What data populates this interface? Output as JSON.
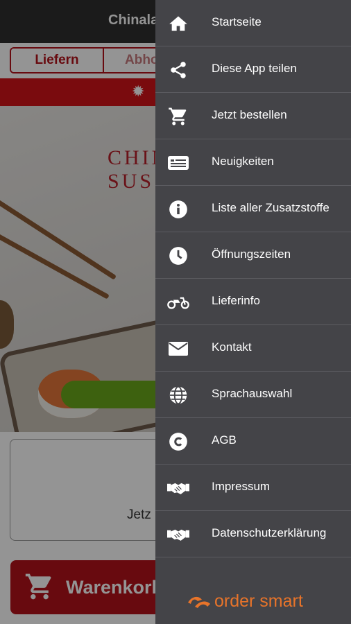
{
  "app": {
    "title": "Chinala",
    "mode_toggle": {
      "deliver": "Liefern",
      "pickup": "Abho"
    },
    "hero_logo_line1": "CHIN",
    "hero_logo_line2": "SUS",
    "info_text": "Jetz",
    "cart_label": "Warenkorl"
  },
  "drawer": {
    "items": [
      {
        "label": "Startseite",
        "icon": "home-icon"
      },
      {
        "label": "Diese App teilen",
        "icon": "share-icon"
      },
      {
        "label": "Jetzt bestellen",
        "icon": "cart-icon"
      },
      {
        "label": "Neuigkeiten",
        "icon": "news-icon"
      },
      {
        "label": "Liste aller Zusatzstoffe",
        "icon": "info-icon"
      },
      {
        "label": "Öffnungszeiten",
        "icon": "clock-icon"
      },
      {
        "label": "Lieferinfo",
        "icon": "motorbike-icon"
      },
      {
        "label": "Kontakt",
        "icon": "envelope-icon"
      },
      {
        "label": "Sprachauswahl",
        "icon": "globe-icon"
      },
      {
        "label": "AGB",
        "icon": "copyright-icon"
      },
      {
        "label": "Impressum",
        "icon": "handshake-icon"
      },
      {
        "label": "Datenschutzerklärung",
        "icon": "handshake-icon"
      }
    ],
    "brand": "order smart"
  },
  "colors": {
    "drawer_bg": "#444448",
    "accent_red": "#b3121a",
    "order_green": "#69a81a",
    "brand_orange": "#e8742a"
  }
}
